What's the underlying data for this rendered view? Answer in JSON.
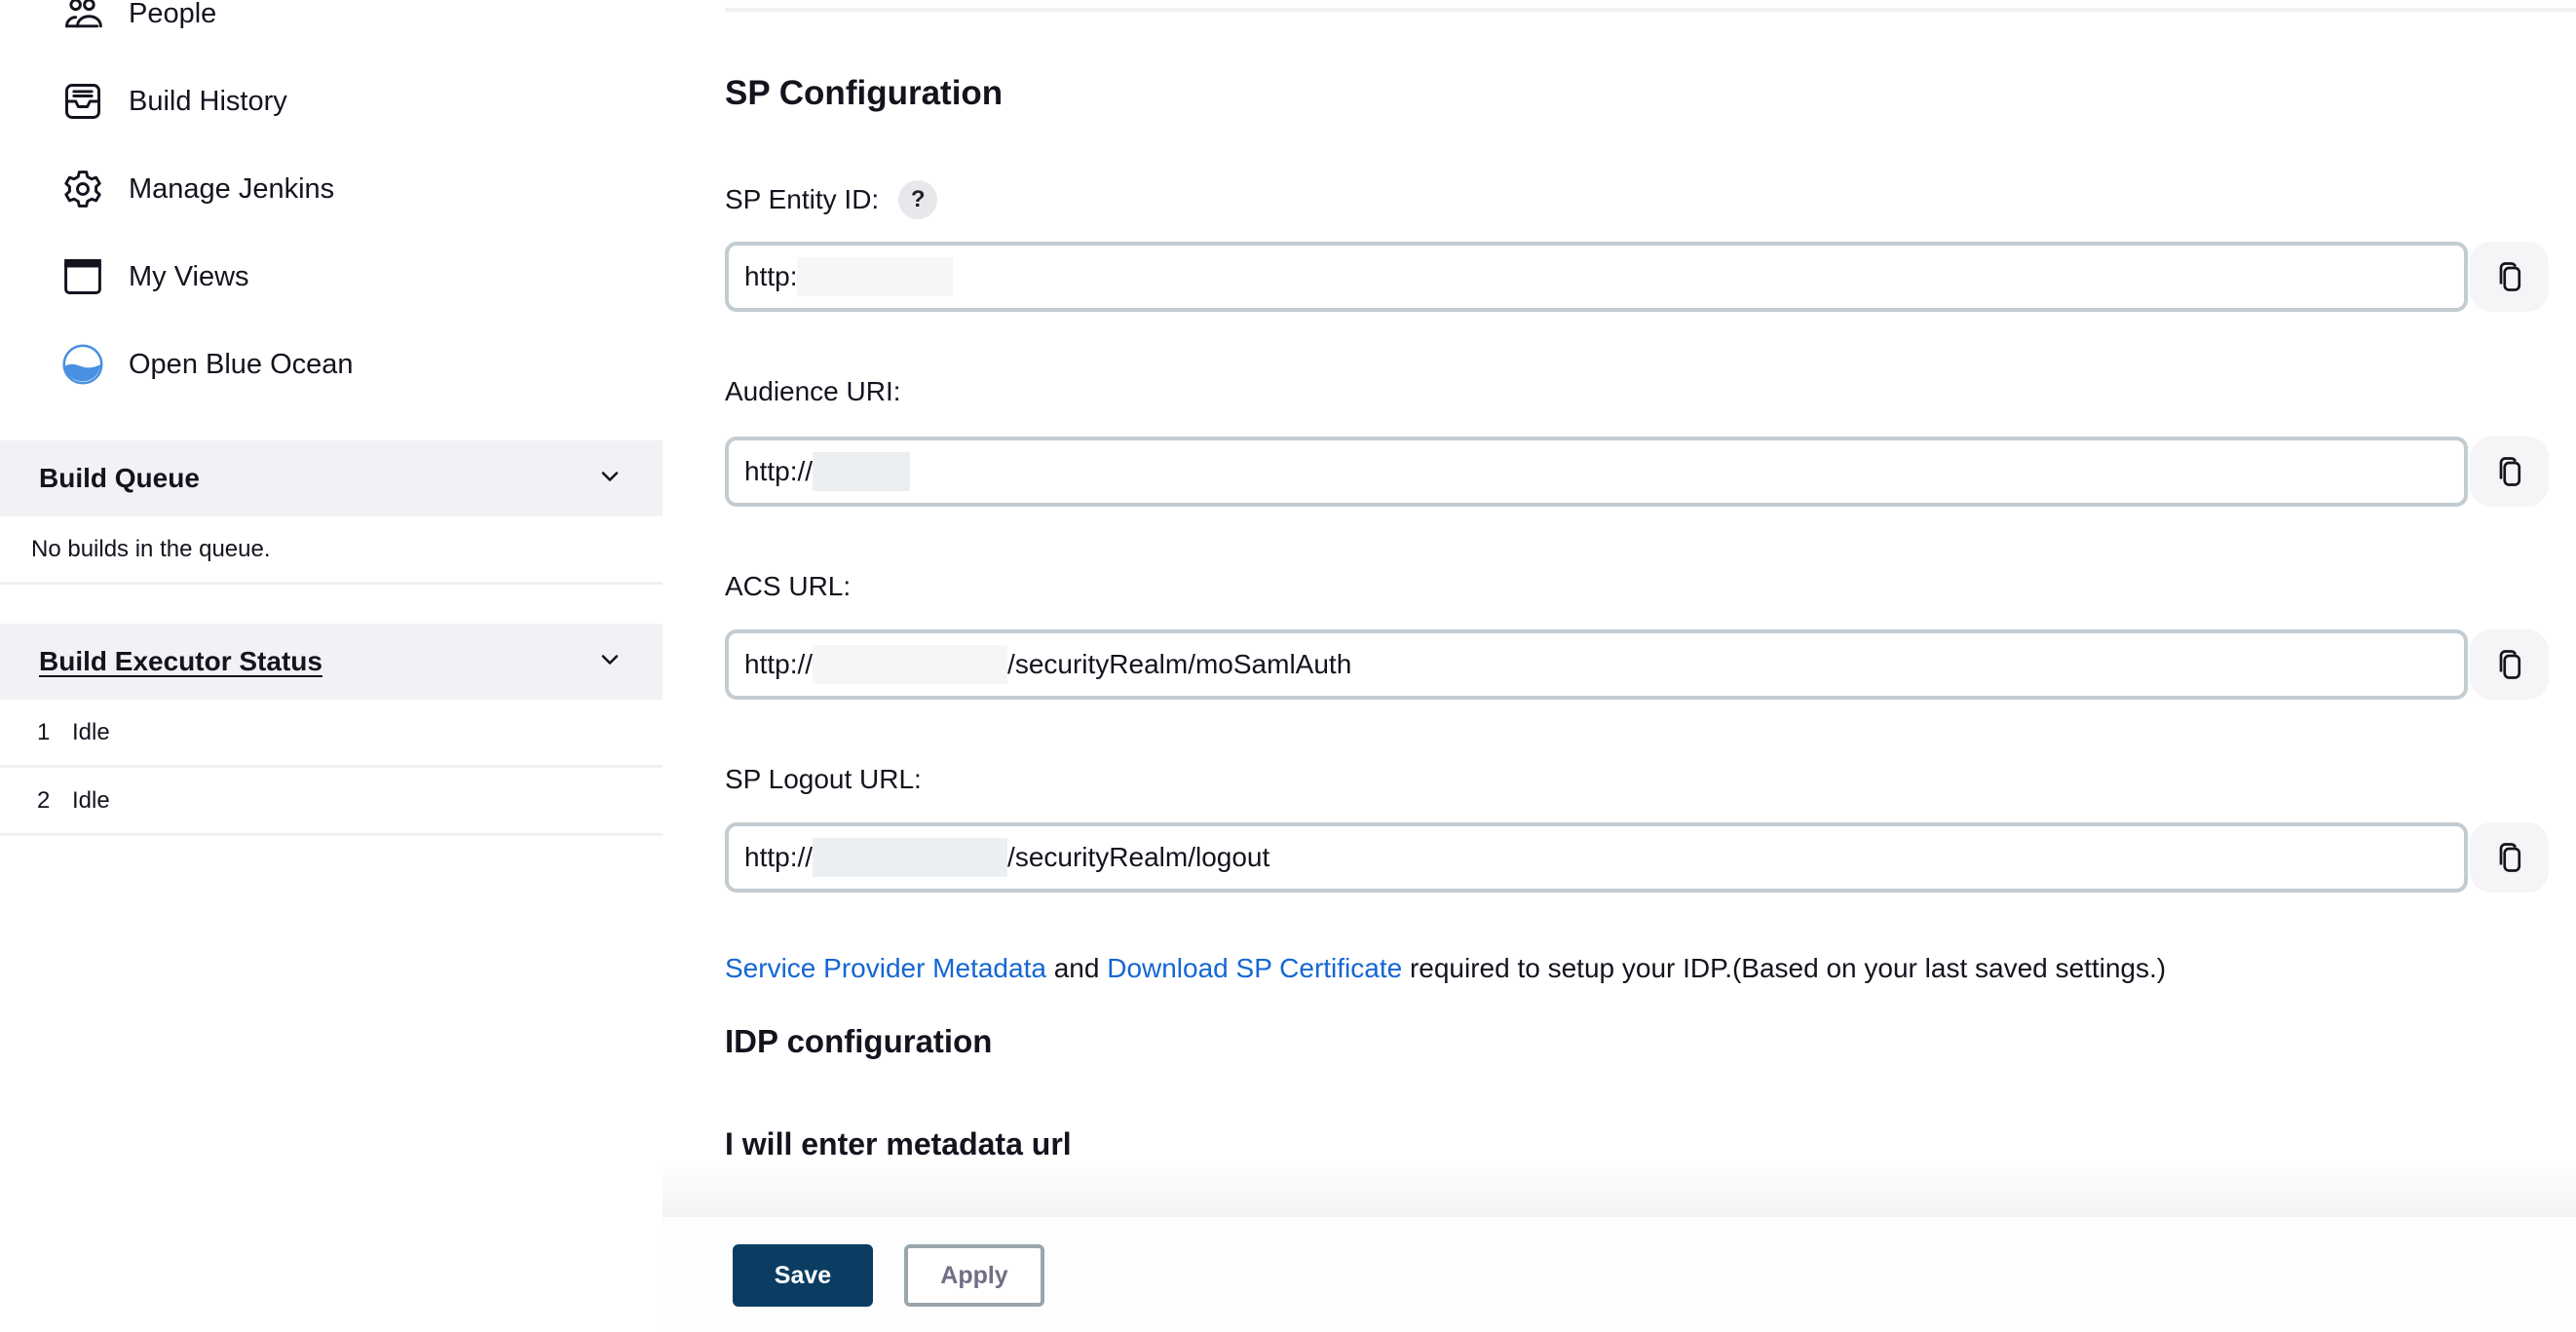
{
  "sidebar": {
    "tasks": [
      {
        "label": "People",
        "icon": "people-icon"
      },
      {
        "label": "Build History",
        "icon": "inbox-tray-icon"
      },
      {
        "label": "Manage Jenkins",
        "icon": "gear-icon"
      },
      {
        "label": "My Views",
        "icon": "window-icon"
      },
      {
        "label": "Open Blue Ocean",
        "icon": "blue-ocean-icon"
      }
    ],
    "build_queue": {
      "title": "Build Queue",
      "empty_text": "No builds in the queue."
    },
    "executor_status": {
      "title": "Build Executor Status",
      "executors": [
        {
          "number": "1",
          "state": "Idle"
        },
        {
          "number": "2",
          "state": "Idle"
        }
      ]
    }
  },
  "main": {
    "sp_section_title": "SP Configuration",
    "fields": [
      {
        "label": "SP Entity ID:",
        "value_prefix": "http:",
        "value_suffix": "",
        "has_help": true,
        "help_symbol": "?"
      },
      {
        "label": "Audience URI:",
        "value_prefix": "http://",
        "value_suffix": "",
        "has_help": false
      },
      {
        "label": "ACS URL:",
        "value_prefix": "http://",
        "value_suffix": "/securityRealm/moSamlAuth",
        "has_help": false
      },
      {
        "label": "SP Logout URL:",
        "value_prefix": "http://",
        "value_suffix": "/securityRealm/logout",
        "has_help": false
      }
    ],
    "info": {
      "link1": "Service Provider Metadata",
      "and": " and ",
      "link2": "Download SP Certificate",
      "rest": " required to setup your IDP.(Based on your last saved settings.)"
    },
    "idp_section_title": "IDP configuration",
    "metadata_subtitle": "I will enter metadata url"
  },
  "footer": {
    "save_label": "Save",
    "apply_label": "Apply"
  },
  "colors": {
    "primary_button": "#0b3d62",
    "link": "#1466d4",
    "pane_header_bg": "#f2f2f6",
    "input_border": "#c3ccd1"
  }
}
